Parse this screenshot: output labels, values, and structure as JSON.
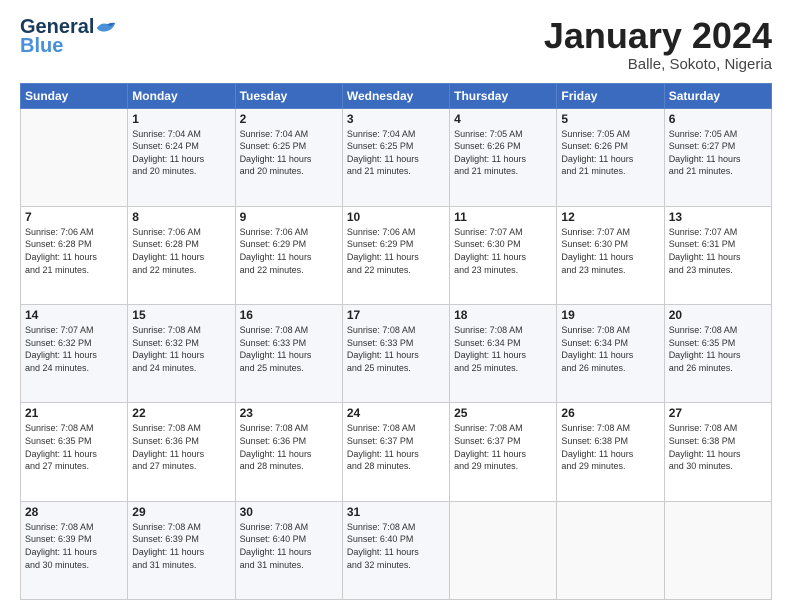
{
  "header": {
    "logo": {
      "general": "General",
      "blue": "Blue"
    },
    "title": "January 2024",
    "location": "Balle, Sokoto, Nigeria"
  },
  "calendar": {
    "headers": [
      "Sunday",
      "Monday",
      "Tuesday",
      "Wednesday",
      "Thursday",
      "Friday",
      "Saturday"
    ],
    "weeks": [
      [
        {
          "day": "",
          "info": ""
        },
        {
          "day": "1",
          "info": "Sunrise: 7:04 AM\nSunset: 6:24 PM\nDaylight: 11 hours\nand 20 minutes."
        },
        {
          "day": "2",
          "info": "Sunrise: 7:04 AM\nSunset: 6:25 PM\nDaylight: 11 hours\nand 20 minutes."
        },
        {
          "day": "3",
          "info": "Sunrise: 7:04 AM\nSunset: 6:25 PM\nDaylight: 11 hours\nand 21 minutes."
        },
        {
          "day": "4",
          "info": "Sunrise: 7:05 AM\nSunset: 6:26 PM\nDaylight: 11 hours\nand 21 minutes."
        },
        {
          "day": "5",
          "info": "Sunrise: 7:05 AM\nSunset: 6:26 PM\nDaylight: 11 hours\nand 21 minutes."
        },
        {
          "day": "6",
          "info": "Sunrise: 7:05 AM\nSunset: 6:27 PM\nDaylight: 11 hours\nand 21 minutes."
        }
      ],
      [
        {
          "day": "7",
          "info": "Sunrise: 7:06 AM\nSunset: 6:28 PM\nDaylight: 11 hours\nand 21 minutes."
        },
        {
          "day": "8",
          "info": "Sunrise: 7:06 AM\nSunset: 6:28 PM\nDaylight: 11 hours\nand 22 minutes."
        },
        {
          "day": "9",
          "info": "Sunrise: 7:06 AM\nSunset: 6:29 PM\nDaylight: 11 hours\nand 22 minutes."
        },
        {
          "day": "10",
          "info": "Sunrise: 7:06 AM\nSunset: 6:29 PM\nDaylight: 11 hours\nand 22 minutes."
        },
        {
          "day": "11",
          "info": "Sunrise: 7:07 AM\nSunset: 6:30 PM\nDaylight: 11 hours\nand 23 minutes."
        },
        {
          "day": "12",
          "info": "Sunrise: 7:07 AM\nSunset: 6:30 PM\nDaylight: 11 hours\nand 23 minutes."
        },
        {
          "day": "13",
          "info": "Sunrise: 7:07 AM\nSunset: 6:31 PM\nDaylight: 11 hours\nand 23 minutes."
        }
      ],
      [
        {
          "day": "14",
          "info": "Sunrise: 7:07 AM\nSunset: 6:32 PM\nDaylight: 11 hours\nand 24 minutes."
        },
        {
          "day": "15",
          "info": "Sunrise: 7:08 AM\nSunset: 6:32 PM\nDaylight: 11 hours\nand 24 minutes."
        },
        {
          "day": "16",
          "info": "Sunrise: 7:08 AM\nSunset: 6:33 PM\nDaylight: 11 hours\nand 25 minutes."
        },
        {
          "day": "17",
          "info": "Sunrise: 7:08 AM\nSunset: 6:33 PM\nDaylight: 11 hours\nand 25 minutes."
        },
        {
          "day": "18",
          "info": "Sunrise: 7:08 AM\nSunset: 6:34 PM\nDaylight: 11 hours\nand 25 minutes."
        },
        {
          "day": "19",
          "info": "Sunrise: 7:08 AM\nSunset: 6:34 PM\nDaylight: 11 hours\nand 26 minutes."
        },
        {
          "day": "20",
          "info": "Sunrise: 7:08 AM\nSunset: 6:35 PM\nDaylight: 11 hours\nand 26 minutes."
        }
      ],
      [
        {
          "day": "21",
          "info": "Sunrise: 7:08 AM\nSunset: 6:35 PM\nDaylight: 11 hours\nand 27 minutes."
        },
        {
          "day": "22",
          "info": "Sunrise: 7:08 AM\nSunset: 6:36 PM\nDaylight: 11 hours\nand 27 minutes."
        },
        {
          "day": "23",
          "info": "Sunrise: 7:08 AM\nSunset: 6:36 PM\nDaylight: 11 hours\nand 28 minutes."
        },
        {
          "day": "24",
          "info": "Sunrise: 7:08 AM\nSunset: 6:37 PM\nDaylight: 11 hours\nand 28 minutes."
        },
        {
          "day": "25",
          "info": "Sunrise: 7:08 AM\nSunset: 6:37 PM\nDaylight: 11 hours\nand 29 minutes."
        },
        {
          "day": "26",
          "info": "Sunrise: 7:08 AM\nSunset: 6:38 PM\nDaylight: 11 hours\nand 29 minutes."
        },
        {
          "day": "27",
          "info": "Sunrise: 7:08 AM\nSunset: 6:38 PM\nDaylight: 11 hours\nand 30 minutes."
        }
      ],
      [
        {
          "day": "28",
          "info": "Sunrise: 7:08 AM\nSunset: 6:39 PM\nDaylight: 11 hours\nand 30 minutes."
        },
        {
          "day": "29",
          "info": "Sunrise: 7:08 AM\nSunset: 6:39 PM\nDaylight: 11 hours\nand 31 minutes."
        },
        {
          "day": "30",
          "info": "Sunrise: 7:08 AM\nSunset: 6:40 PM\nDaylight: 11 hours\nand 31 minutes."
        },
        {
          "day": "31",
          "info": "Sunrise: 7:08 AM\nSunset: 6:40 PM\nDaylight: 11 hours\nand 32 minutes."
        },
        {
          "day": "",
          "info": ""
        },
        {
          "day": "",
          "info": ""
        },
        {
          "day": "",
          "info": ""
        }
      ]
    ]
  }
}
